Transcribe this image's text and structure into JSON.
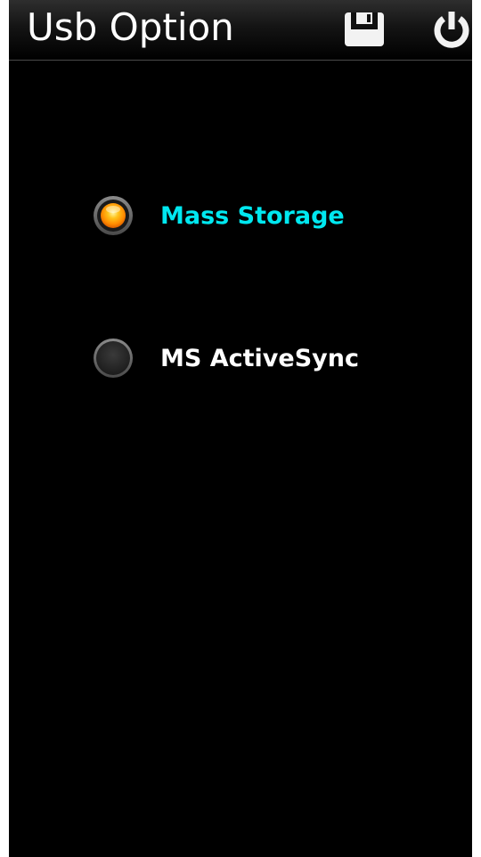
{
  "header": {
    "title": "Usb Option",
    "save_icon": "floppy-disk-icon",
    "power_icon": "power-icon"
  },
  "options": [
    {
      "label": "Mass Storage",
      "selected": true
    },
    {
      "label": "MS ActiveSync",
      "selected": false
    }
  ],
  "colors": {
    "background": "#000000",
    "selected_label": "#00e8f0",
    "normal_label": "#ffffff",
    "radio_selected": "#ff9a00",
    "radio_unselected": "#2a2a2a"
  }
}
